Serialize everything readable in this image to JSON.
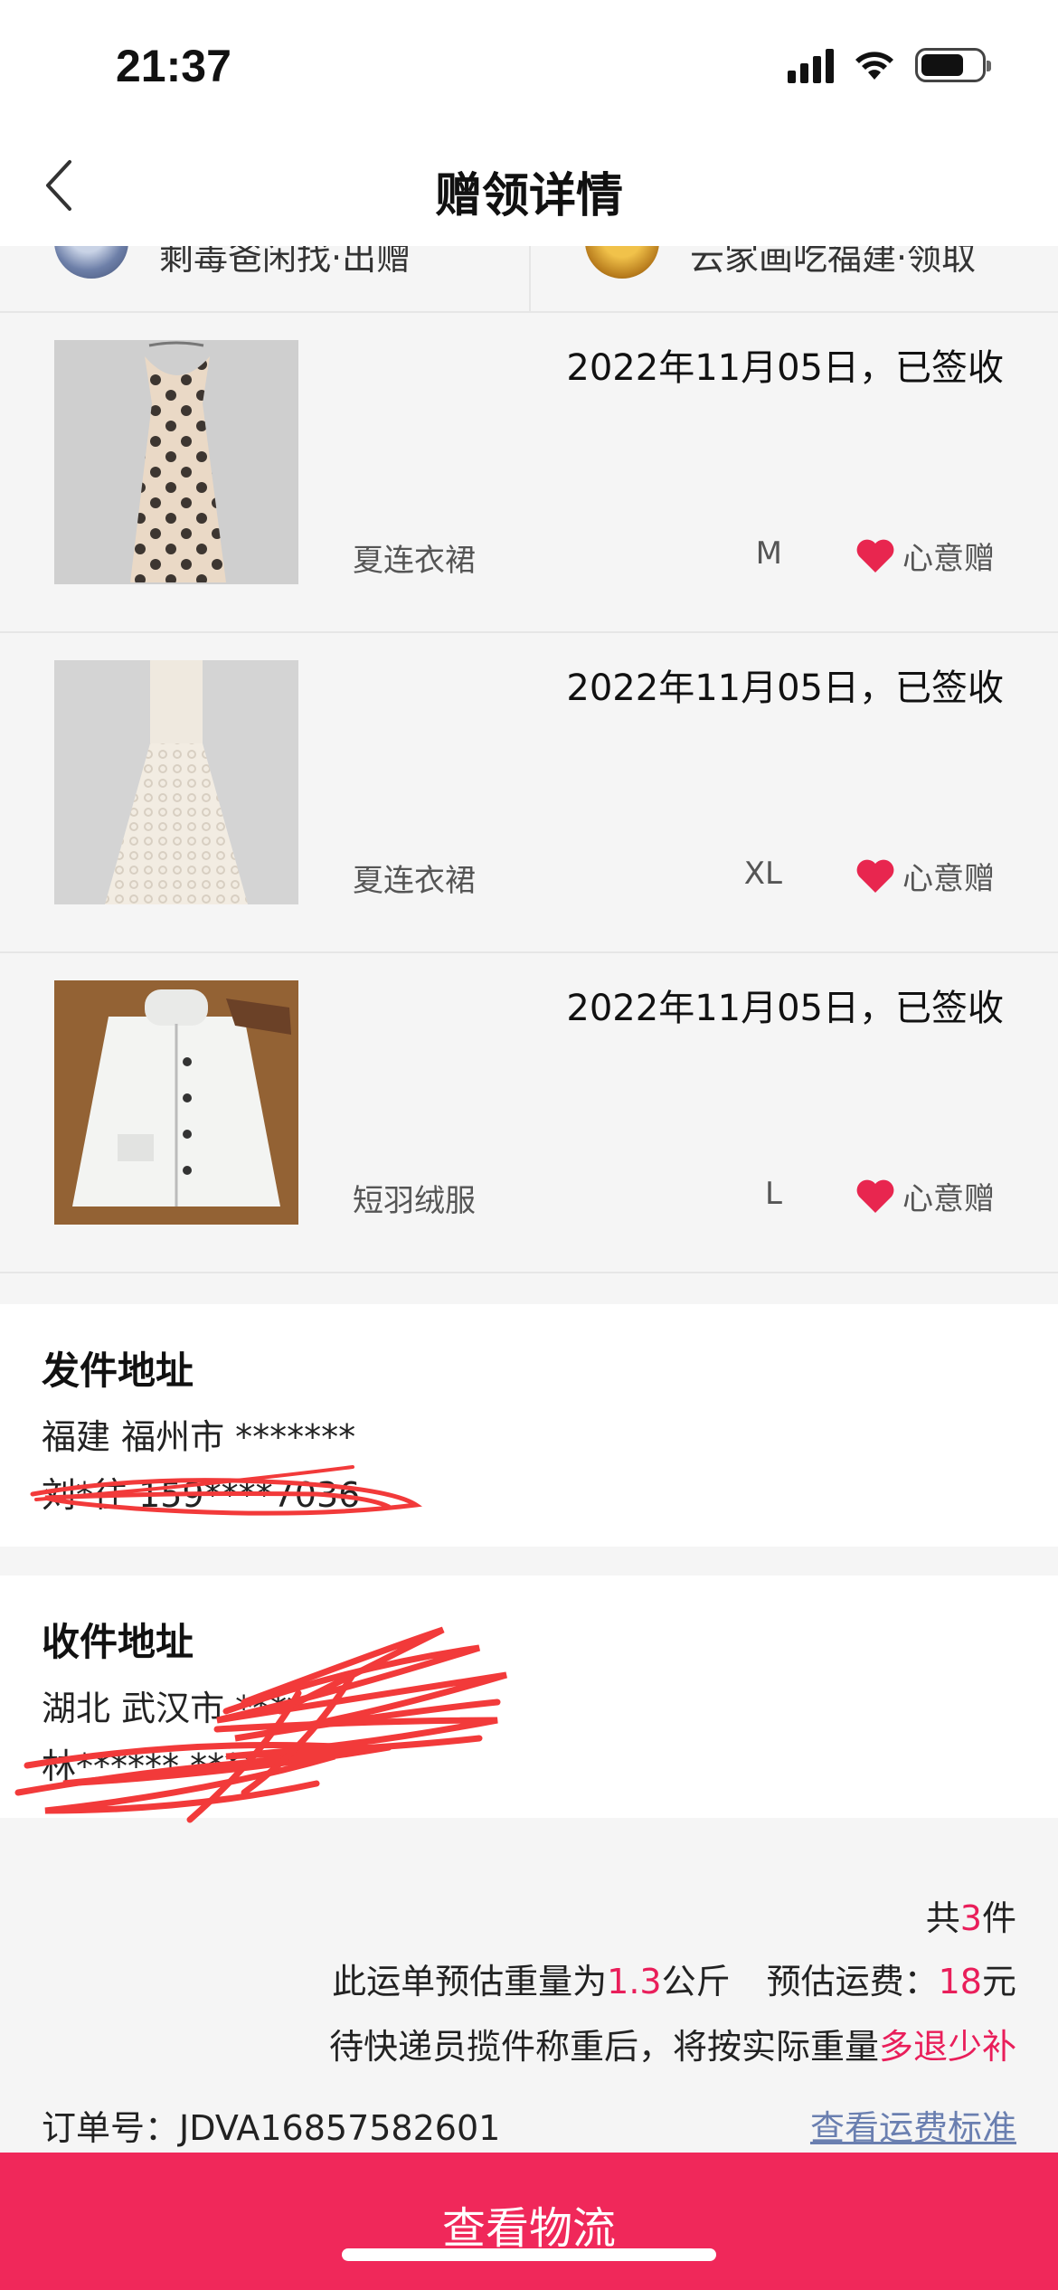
{
  "status_bar": {
    "time": "21:37"
  },
  "nav": {
    "title": "赠领详情"
  },
  "users": {
    "giver_label": "剩毒爸闲找·出赠",
    "receiver_label": "云家画吃福建·领取"
  },
  "items": [
    {
      "date": "2022年11月05日，已签收",
      "name": "夏连衣裙",
      "size": "M",
      "tag": "心意赠",
      "photo": "polka-dot-dress"
    },
    {
      "date": "2022年11月05日，已签收",
      "name": "夏连衣裙",
      "size": "XL",
      "tag": "心意赠",
      "photo": "lace-dress"
    },
    {
      "date": "2022年11月05日，已签收",
      "name": "短羽绒服",
      "size": "L",
      "tag": "心意赠",
      "photo": "white-puffer-jacket"
    }
  ],
  "sender": {
    "title": "发件地址",
    "line1": "福建 福州市 *******",
    "line2": "刘*往 159****7036"
  },
  "receiver": {
    "title": "收件地址",
    "line1": "湖北 武汉市 ****",
    "line2": "林****** ****"
  },
  "summary": {
    "count_prefix": "共",
    "count": "3",
    "count_suffix": "件",
    "weight_prefix": "此运单预估重量为",
    "weight": "1.3",
    "weight_unit": "公斤",
    "fee_prefix": "预估运费：",
    "fee": "18",
    "fee_unit": "元",
    "note_prefix": "待快递员揽件称重后，将按实际重量",
    "note_accent": "多退少补",
    "order_label": "订单号：",
    "order_no": "JDVA16857582601",
    "fee_link": "查看运费标准"
  },
  "bottom_button": {
    "label": "查看物流"
  },
  "colors": {
    "accent": "#e91e5a",
    "button": "#f0285a",
    "link": "#6a7fb0",
    "heart": "#e8264f",
    "redact": "#f23a3a"
  }
}
